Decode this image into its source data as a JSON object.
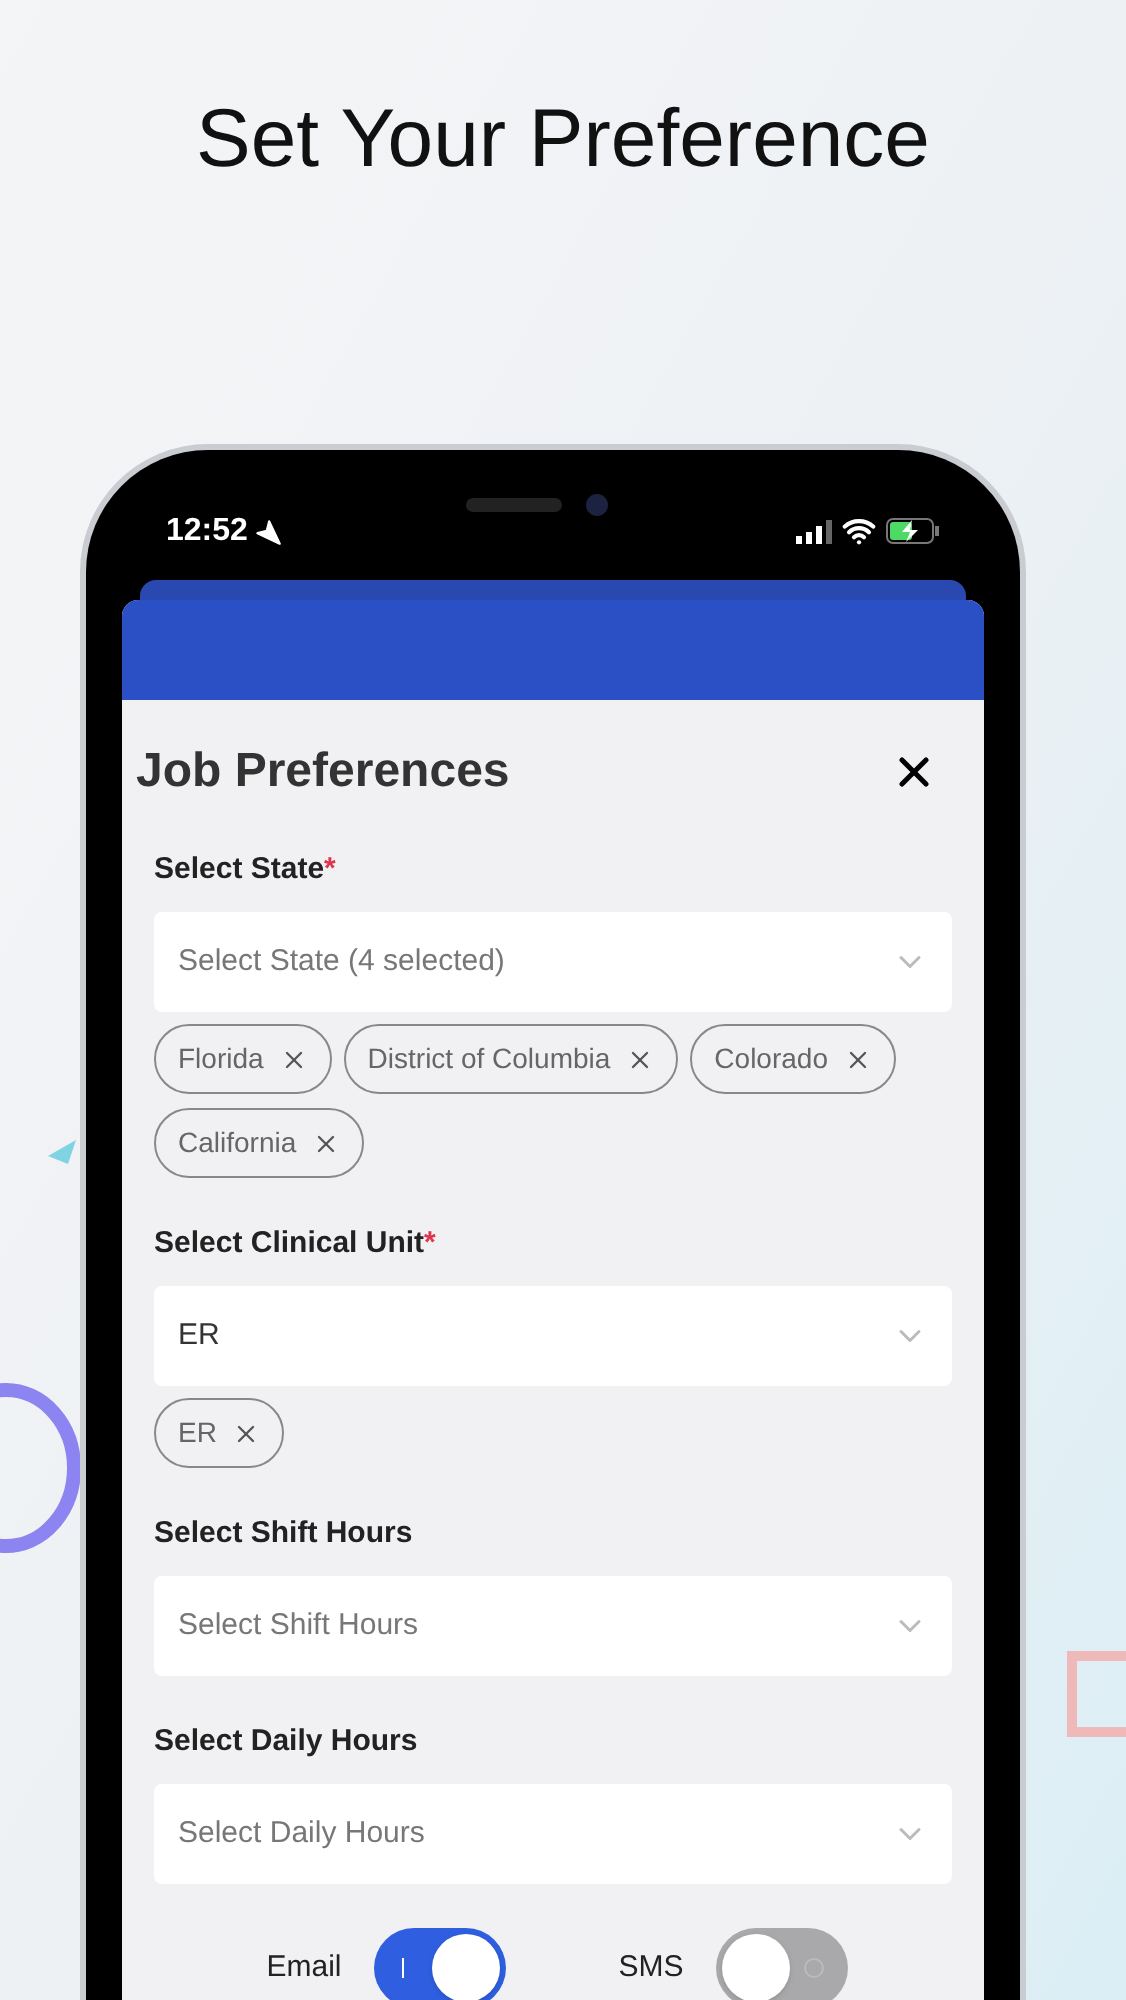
{
  "headline": "Set Your Preference",
  "status_bar": {
    "time": "12:52"
  },
  "modal": {
    "title": "Job Preferences",
    "fields": [
      {
        "label": "Select State",
        "required_mark": "*",
        "placeholder": "Select State (4 selected)",
        "chips": [
          "Florida",
          "District of Columbia",
          "Colorado",
          "California"
        ]
      },
      {
        "label": "Select Clinical Unit",
        "required_mark": "*",
        "value": "ER",
        "chips": [
          "ER"
        ]
      },
      {
        "label": "Select Shift Hours",
        "placeholder": "Select Shift Hours"
      },
      {
        "label": "Select Daily Hours",
        "placeholder": "Select Daily Hours"
      }
    ],
    "toggles": [
      {
        "label": "Email",
        "on": true
      },
      {
        "label": "SMS",
        "on": false
      }
    ]
  }
}
